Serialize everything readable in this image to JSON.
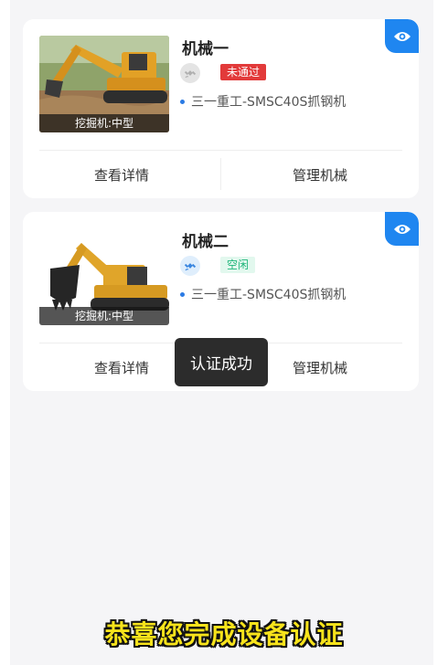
{
  "machines": [
    {
      "name": "机械一",
      "thumb_label": "挖掘机:中型",
      "status": "未通过",
      "model": "三一重工-SMSC40S抓钢机",
      "view_action": "查看详情",
      "manage_action": "管理机械"
    },
    {
      "name": "机械二",
      "thumb_label": "挖掘机:中型",
      "status": "空闲",
      "model": "三一重工-SMSC40S抓钢机",
      "view_action": "查看详情",
      "manage_action": "管理机械"
    }
  ],
  "toast": "认证成功",
  "caption": "恭喜您完成设备认证",
  "icons": [
    "eye-icon",
    "satellite-icon",
    "excavator-photo"
  ],
  "colors": {
    "accent": "#1f86f0",
    "status_failed_bg": "#e23a3a",
    "status_idle_text": "#1fb57a",
    "caption_text": "#f7e31b"
  }
}
